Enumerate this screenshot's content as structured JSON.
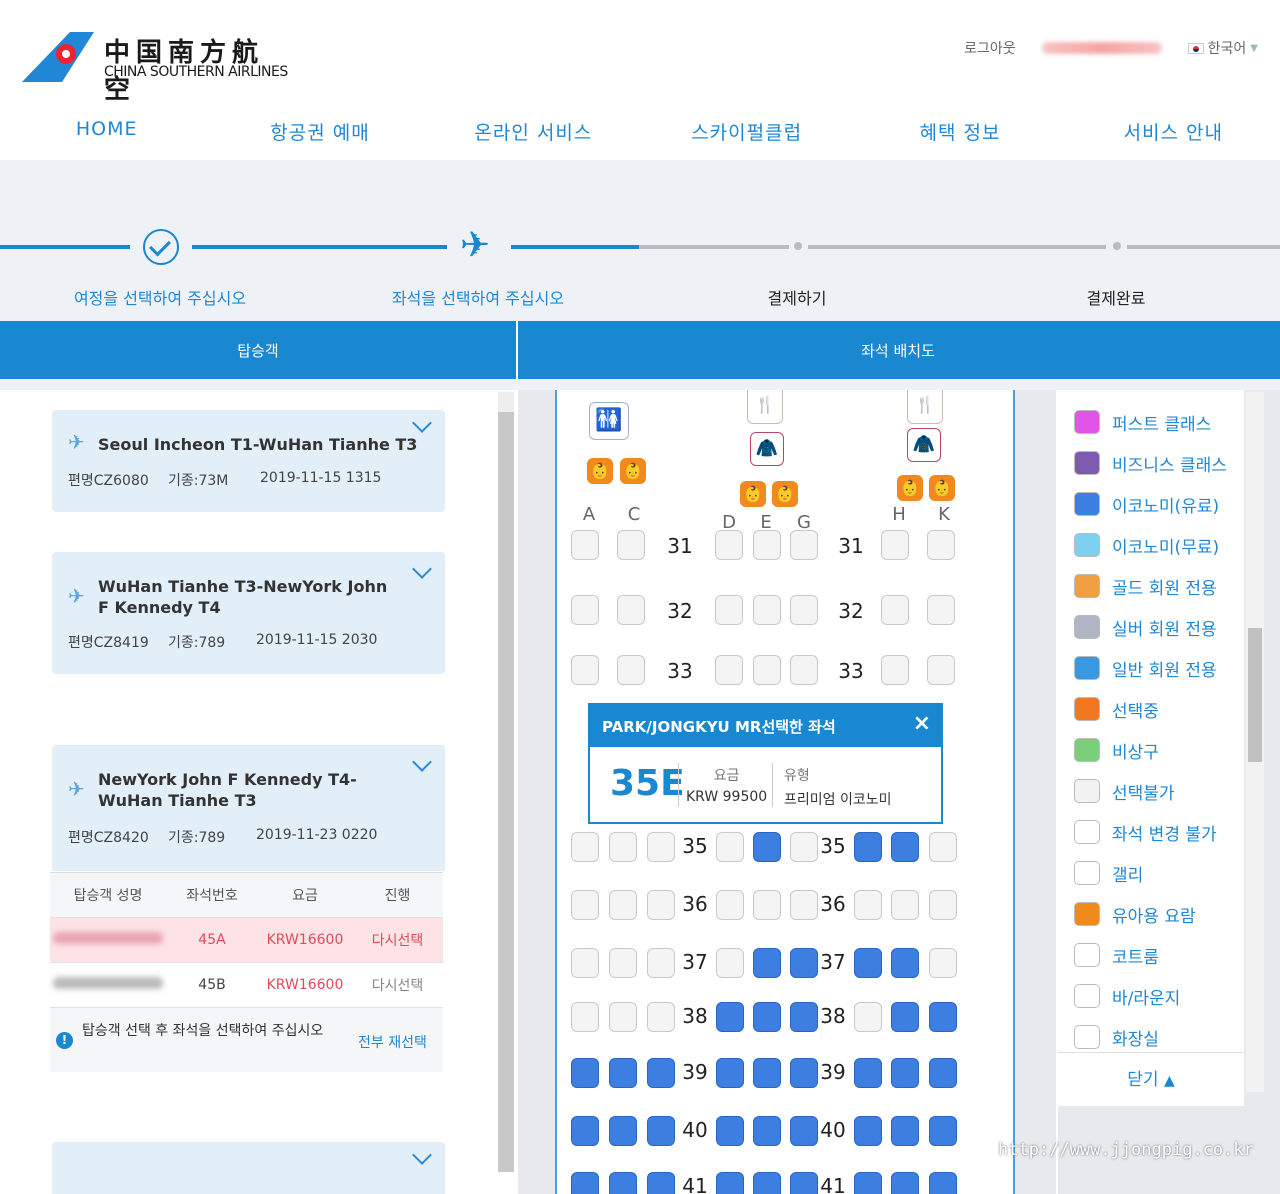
{
  "header": {
    "logo_cn": "中国南方航空",
    "logo_en": "CHINA SOUTHERN AIRLINES",
    "logout": "로그아웃",
    "language": "한국어",
    "lang_arrow": "▼"
  },
  "nav": [
    "HOME",
    "항공권 예매",
    "온라인 서비스",
    "스카이펄클럽",
    "혜택 정보",
    "서비스 안내"
  ],
  "steps": [
    "여정을 선택하여 주십시오",
    "좌석을 선택하여 주십시오",
    "결제하기",
    "결제완료"
  ],
  "tabs": {
    "passenger": "탑승객",
    "seatmap": "좌석 배치도"
  },
  "flights": [
    {
      "route": "Seoul Incheon T1-WuHan Tianhe T3",
      "flight": "편명CZ6080",
      "aircraft": "기종:73M",
      "datetime": "2019-11-15 1315"
    },
    {
      "route": "WuHan Tianhe T3-NewYork John F Kennedy T4",
      "flight": "편명CZ8419",
      "aircraft": "기종:789",
      "datetime": "2019-11-15 2030"
    },
    {
      "route": "NewYork John F Kennedy T4-WuHan Tianhe T3",
      "flight": "편명CZ8420",
      "aircraft": "기종:789",
      "datetime": "2019-11-23 0220"
    }
  ],
  "passenger_table": {
    "headers": [
      "탑승객 성명",
      "좌석번호",
      "요금",
      "진행"
    ],
    "rows": [
      {
        "seat": "45A",
        "fee": "KRW16600",
        "action": "다시선택"
      },
      {
        "seat": "45B",
        "fee": "KRW16600",
        "action": "다시선택"
      }
    ],
    "notice": "탑승객 선택 후 좌석을 선택하여 주십시오",
    "reselect_all": "전부 재선택"
  },
  "seatmap": {
    "cols_top": [
      "A",
      "C",
      "D",
      "E",
      "G",
      "H",
      "K"
    ],
    "rows": [
      "31",
      "32",
      "33",
      "35",
      "36",
      "37",
      "38",
      "39",
      "40",
      "41"
    ]
  },
  "popup": {
    "title": "PARK/JONGKYU MR선택한 좌석",
    "close": "×",
    "seat": "35E",
    "fee_label": "요금",
    "fee": "KRW 99500",
    "type_label": "유형",
    "type": "프리미엄 이코노미"
  },
  "legend": [
    {
      "label": "퍼스트 클래스",
      "color": "#e055e8"
    },
    {
      "label": "비즈니스 클래스",
      "color": "#7d5cb0"
    },
    {
      "label": "이코노미(유료)",
      "color": "#3d7fe0"
    },
    {
      "label": "이코노미(무료)",
      "color": "#7fd0f0"
    },
    {
      "label": "골드 회원 전용",
      "color": "#f0a040"
    },
    {
      "label": "실버 회원 전용",
      "color": "#b0b6c4"
    },
    {
      "label": "일반 회원 전용",
      "color": "#3a98e0"
    },
    {
      "label": "선택중",
      "color": "#f07820"
    },
    {
      "label": "비상구",
      "color": "#7ad07a"
    },
    {
      "label": "선택불가",
      "color": "#f2f2f2"
    },
    {
      "label": "좌석 변경 불가",
      "color": "#ffffff"
    },
    {
      "label": "갤리",
      "color": "#ffffff"
    },
    {
      "label": "유아용 요람",
      "color": "#f08a1c"
    },
    {
      "label": "코트룸",
      "color": "#ffffff"
    },
    {
      "label": "바/라운지",
      "color": "#ffffff"
    },
    {
      "label": "화장실",
      "color": "#ffffff"
    }
  ],
  "legend_close": "닫기",
  "watermark": "http://www.jjongpig.co.kr"
}
